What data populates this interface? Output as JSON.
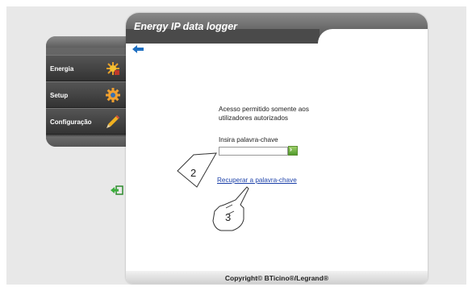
{
  "header": {
    "title": "Energy IP data logger"
  },
  "sidebar": {
    "items": [
      {
        "label": "Energia",
        "icon": "energy-icon"
      },
      {
        "label": "Setup",
        "icon": "gear-icon"
      },
      {
        "label": "Configuração",
        "icon": "pencil-icon"
      }
    ]
  },
  "login": {
    "message": "Acesso permitido somente aos utilizadores autorizados",
    "password_label": "Insira palavra-chave",
    "password_value": "",
    "recover_link": "Recuperar a palavra-chave"
  },
  "footer": {
    "copyright": "Copyright© BTicino®/Legrand®"
  },
  "callouts": [
    "2",
    "3"
  ],
  "colors": {
    "header": "#4a4a4a",
    "link": "#1a3fa8",
    "accent_arrow": "#1e6fc1",
    "go_button": "#4f9a2a"
  }
}
